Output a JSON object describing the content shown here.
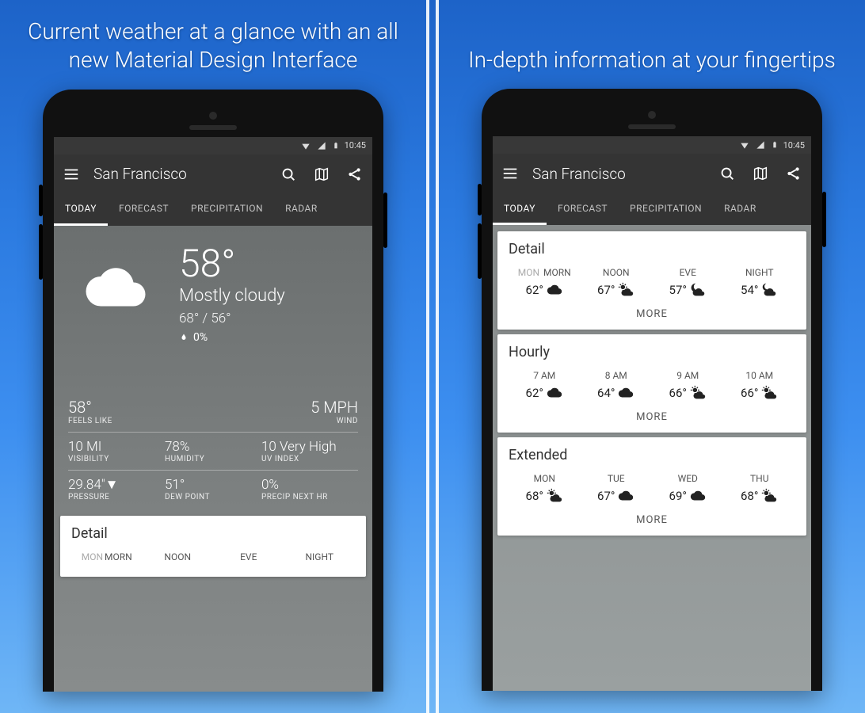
{
  "captions": {
    "left": "Current weather at a glance with an all new Material Design Interface",
    "right": "In-depth information at your fingertips"
  },
  "status": {
    "time": "10:45"
  },
  "appbar": {
    "title": "San Francisco"
  },
  "tabs": [
    "TODAY",
    "FORECAST",
    "PRECIPITATION",
    "RADAR"
  ],
  "hero": {
    "temp": "58°",
    "condition": "Mostly cloudy",
    "range": "68° / 56°",
    "precip": "0%"
  },
  "stats": {
    "feels": {
      "val": "58°",
      "lbl": "FEELS LIKE"
    },
    "wind": {
      "val": "5 MPH",
      "lbl": "WIND"
    },
    "visibility": {
      "val": "10 MI",
      "lbl": "VISIBILITY"
    },
    "humidity": {
      "val": "78%",
      "lbl": "HUMIDITY"
    },
    "uv": {
      "val": "10 Very High",
      "lbl": "UV INDEX"
    },
    "pressure": {
      "val": "29.84\"▼",
      "lbl": "PRESSURE"
    },
    "dew": {
      "val": "51°",
      "lbl": "DEW POINT"
    },
    "pnh": {
      "val": "0%",
      "lbl": "PRECIP NEXT HR"
    }
  },
  "cards": {
    "detail": {
      "title": "Detail",
      "prefix": "MON",
      "cols": [
        {
          "hd": "MORN",
          "vl": "62°",
          "icon": "cloud"
        },
        {
          "hd": "NOON",
          "vl": "67°",
          "icon": "partly"
        },
        {
          "hd": "EVE",
          "vl": "57°",
          "icon": "night-partly"
        },
        {
          "hd": "NIGHT",
          "vl": "54°",
          "icon": "night-cloud"
        }
      ],
      "more": "MORE"
    },
    "hourly": {
      "title": "Hourly",
      "cols": [
        {
          "hd": "7 AM",
          "vl": "62°",
          "icon": "cloud"
        },
        {
          "hd": "8 AM",
          "vl": "64°",
          "icon": "cloud"
        },
        {
          "hd": "9 AM",
          "vl": "66°",
          "icon": "partly"
        },
        {
          "hd": "10 AM",
          "vl": "66°",
          "icon": "partly"
        }
      ],
      "more": "MORE"
    },
    "extended": {
      "title": "Extended",
      "cols": [
        {
          "hd": "MON",
          "vl": "68°",
          "icon": "partly"
        },
        {
          "hd": "TUE",
          "vl": "67°",
          "icon": "cloud"
        },
        {
          "hd": "WED",
          "vl": "69°",
          "icon": "cloud"
        },
        {
          "hd": "THU",
          "vl": "68°",
          "icon": "partly"
        }
      ],
      "more": "MORE"
    },
    "detail_peek": {
      "title": "Detail",
      "prefix": "MON",
      "cols": [
        {
          "hd": "MORN"
        },
        {
          "hd": "NOON"
        },
        {
          "hd": "EVE"
        },
        {
          "hd": "NIGHT"
        }
      ]
    }
  }
}
